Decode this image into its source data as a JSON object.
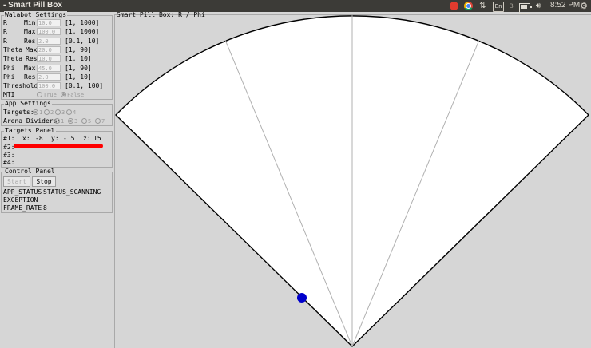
{
  "window": {
    "title": "- Smart Pill Box"
  },
  "systray": {
    "lang": "En",
    "clock": "8:52 PM",
    "battery_level": 0.75
  },
  "walabot_settings": {
    "legend": "Walabot Settings",
    "rows": [
      {
        "label": "R",
        "sub": "Min",
        "value": "10.0",
        "range": "[1, 1000]"
      },
      {
        "label": "R",
        "sub": "Max",
        "value": "100.0",
        "range": "[1, 1000]"
      },
      {
        "label": "R",
        "sub": "Res",
        "value": "2.0",
        "range": "[0.1, 10]"
      },
      {
        "label": "Theta",
        "sub": "Max",
        "value": "20.0",
        "range": "[1, 90]"
      },
      {
        "label": "Theta",
        "sub": "Res",
        "value": "10.0",
        "range": "[1, 10]"
      },
      {
        "label": "Phi",
        "sub": "Max",
        "value": "45.0",
        "range": "[1, 90]"
      },
      {
        "label": "Phi",
        "sub": "Res",
        "value": "2.0",
        "range": "[1, 10]"
      },
      {
        "label": "Threshold",
        "sub": "",
        "value": "100.0",
        "range": "[0.1, 100]"
      }
    ],
    "mti": {
      "label": "MTI",
      "options": [
        "True",
        "False"
      ],
      "selected": "False"
    }
  },
  "app_settings": {
    "legend": "App Settings",
    "targets": {
      "label": "Targets:",
      "options": [
        "1",
        "2",
        "3",
        "4"
      ],
      "selected": "1"
    },
    "arena_dividers": {
      "label": "Arena Dividers:",
      "options": [
        "1",
        "3",
        "5",
        "7"
      ],
      "selected": "3"
    }
  },
  "targets_panel": {
    "legend": "Targets Panel",
    "targets": [
      {
        "id": "#1:",
        "x_label": "x:",
        "x": "-8",
        "y_label": "y:",
        "y": "-15",
        "z_label": "z:",
        "z": "15"
      },
      {
        "id": "#2:"
      },
      {
        "id": "#3:"
      },
      {
        "id": "#4:"
      }
    ]
  },
  "control_panel": {
    "legend": "Control Panel",
    "start_label": "Start",
    "stop_label": "Stop",
    "status": [
      {
        "key": "APP_STATUS",
        "value": "STATUS_SCANNING"
      },
      {
        "key": "EXCEPTION",
        "value": ""
      },
      {
        "key": "FRAME_RATE",
        "value": "8"
      }
    ]
  },
  "canvas": {
    "legend": "Smart Pill Box: R / Phi",
    "arena_dividers": 3,
    "target_color": "#0000cc"
  },
  "colors": {
    "accent_red": "#ff0000",
    "topbar": "#3c3b37",
    "panel_bg": "#d6d6d6"
  }
}
